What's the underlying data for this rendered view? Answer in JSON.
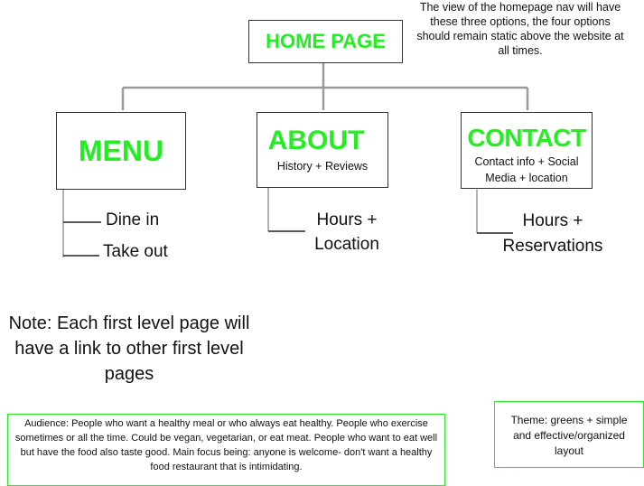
{
  "title_note": "The view of the homepage nav will have these three options, the four options should remain static above the website at all times.",
  "home": {
    "label": "HOME PAGE"
  },
  "nav": [
    {
      "label": "MENU",
      "sub": "",
      "children": [
        "Dine in",
        "Take out"
      ]
    },
    {
      "label": "ABOUT",
      "sub": "History + Reviews",
      "children": [
        "Hours + Location"
      ]
    },
    {
      "label": "CONTACT",
      "sub": "Contact info + Social Media + location",
      "children": [
        "Hours + Reservations"
      ]
    }
  ],
  "note": "Note: Each first level page will have a link to other first level pages",
  "audience": "Audience: People who want a healthy meal or who always eat healthy. People who exercise sometimes or all the time. Could be vegan, vegetarian, or eat meat. People who want to eat well but have the food also taste good. Main focus being: anyone is welcome- don't want a healthy food restaurant that is intimidating.",
  "theme": "Theme: greens + simple and effective/organized layout",
  "colors": {
    "accent": "#22ee22",
    "connector": "#9a9a9a",
    "border": "#333333"
  }
}
